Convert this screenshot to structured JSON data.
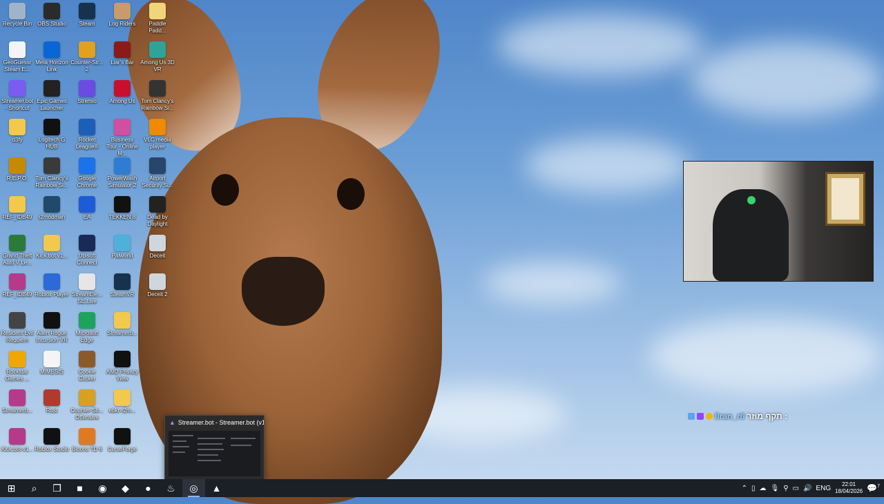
{
  "desktop_icons": [
    {
      "label": "Recycle Bin",
      "icon": "recycle-bin-icon",
      "color": "#9fb4c8"
    },
    {
      "label": "OBS Studio",
      "icon": "obs-icon",
      "color": "#2b2b2b"
    },
    {
      "label": "Steam",
      "icon": "steam-icon",
      "color": "#17324d"
    },
    {
      "label": "Log Riders",
      "icon": "game-icon",
      "color": "#c99b6b"
    },
    {
      "label": "Paddle Padd...",
      "icon": "game-icon",
      "color": "#f0d57a"
    },
    {
      "label": "GeoGuessr Steam E...",
      "icon": "file-icon",
      "color": "#f4f4f4"
    },
    {
      "label": "Meta Horizon Link",
      "icon": "meta-icon",
      "color": "#0a66d6"
    },
    {
      "label": "Counter-Str... 2",
      "icon": "game-icon",
      "color": "#e0a020"
    },
    {
      "label": "Liar's Bar",
      "icon": "game-icon",
      "color": "#8b1a1a"
    },
    {
      "label": "Among Us 3D VR",
      "icon": "game-icon",
      "color": "#2fa39a"
    },
    {
      "label": "Streamer.bot - Shortcut",
      "icon": "streamerbot-icon",
      "color": "#7b5cf0"
    },
    {
      "label": "Epic Games Launcher",
      "icon": "epic-icon",
      "color": "#222"
    },
    {
      "label": "Stremio",
      "icon": "stremio-icon",
      "color": "#6a4ce0"
    },
    {
      "label": "Among Us",
      "icon": "game-icon",
      "color": "#c8102e"
    },
    {
      "label": "Tom Clancy's Rainbow Si...",
      "icon": "game-icon",
      "color": "#333"
    },
    {
      "label": "d3fy",
      "icon": "folder-icon",
      "color": "#f2c94c"
    },
    {
      "label": "Logitech G HUB",
      "icon": "logitech-icon",
      "color": "#111"
    },
    {
      "label": "Rocket League®",
      "icon": "game-icon",
      "color": "#1d5fb8"
    },
    {
      "label": "Business Tour - Online M...",
      "icon": "game-icon",
      "color": "#d04fa0"
    },
    {
      "label": "VLC media player",
      "icon": "vlc-icon",
      "color": "#f08a00"
    },
    {
      "label": "R.E.P.O.",
      "icon": "game-icon",
      "color": "#c58a00"
    },
    {
      "label": "Tom Clancy's Rainbow Si...",
      "icon": "game-icon",
      "color": "#3a3a3a"
    },
    {
      "label": "Google Chrome",
      "icon": "chrome-icon",
      "color": "#1a73e8"
    },
    {
      "label": "PowerWash Simulator 2",
      "icon": "game-icon",
      "color": "#2f7dd3"
    },
    {
      "label": "Airport Security Si...",
      "icon": "game-icon",
      "color": "#27466a"
    },
    {
      "label": "REF_IDB49",
      "icon": "folder-icon",
      "color": "#f2c94c"
    },
    {
      "label": "r2modman",
      "icon": "r2modman-icon",
      "color": "#214a6a"
    },
    {
      "label": "EA",
      "icon": "ea-icon",
      "color": "#1e5bd8"
    },
    {
      "label": "TEKKEN 8",
      "icon": "game-icon",
      "color": "#111"
    },
    {
      "label": "Dead by Daylight",
      "icon": "game-icon",
      "color": "#222"
    },
    {
      "label": "Grand Theft Auto V Le...",
      "icon": "game-icon",
      "color": "#2c7a3a"
    },
    {
      "label": "Kick.bot v1...",
      "icon": "folder-icon",
      "color": "#f2c94c"
    },
    {
      "label": "Ubisoft Connect",
      "icon": "ubisoft-icon",
      "color": "#1a2a55"
    },
    {
      "label": "Palworld",
      "icon": "game-icon",
      "color": "#4fb0d9"
    },
    {
      "label": "Deceit",
      "icon": "game-icon",
      "color": "#cfd6dd"
    },
    {
      "label": "REF_IDB49",
      "icon": "archive-icon",
      "color": "#b53a8a"
    },
    {
      "label": "Roblox Player",
      "icon": "roblox-icon",
      "color": "#2b6ad8"
    },
    {
      "label": "StreamEle... SE.Live",
      "icon": "streamelements-icon",
      "color": "#e6e6e6"
    },
    {
      "label": "SteamVR",
      "icon": "steamvr-icon",
      "color": "#17324d"
    },
    {
      "label": "Deceit 2",
      "icon": "game-icon",
      "color": "#cfd6dd"
    },
    {
      "label": "Resident Evil Requiem",
      "icon": "game-icon",
      "color": "#444"
    },
    {
      "label": "Alien Rogue Incursion VR",
      "icon": "game-icon",
      "color": "#111"
    },
    {
      "label": "Microsoft Edge",
      "icon": "edge-icon",
      "color": "#1fa35c"
    },
    {
      "label": "Streamerb...",
      "icon": "folder-icon",
      "color": "#f2c94c"
    },
    {
      "label": "",
      "icon": "",
      "color": ""
    },
    {
      "label": "Rockstar Games ...",
      "icon": "rockstar-icon",
      "color": "#f0a800"
    },
    {
      "label": "MIMESIS",
      "icon": "file-icon",
      "color": "#f4f4f4"
    },
    {
      "label": "Cookie Clicker",
      "icon": "cookie-icon",
      "color": "#8b5a2b"
    },
    {
      "label": "AMD Privacy View",
      "icon": "amd-icon",
      "color": "#111"
    },
    {
      "label": "",
      "icon": "",
      "color": ""
    },
    {
      "label": "Streamerb...",
      "icon": "archive-icon",
      "color": "#b53a8a"
    },
    {
      "label": "Rust",
      "icon": "game-icon",
      "color": "#b03a2e"
    },
    {
      "label": "Counter-Str... Offensive",
      "icon": "game-icon",
      "color": "#d8a020"
    },
    {
      "label": "ebkr-r2m...",
      "icon": "folder-icon",
      "color": "#f2c94c"
    },
    {
      "label": "",
      "icon": "",
      "color": ""
    },
    {
      "label": "Kick.bot-v1...",
      "icon": "archive-icon",
      "color": "#b53a8a"
    },
    {
      "label": "Roblox Studio",
      "icon": "roblox-studio-icon",
      "color": "#111"
    },
    {
      "label": "Bloons TD 6",
      "icon": "game-icon",
      "color": "#e07a20"
    },
    {
      "label": "CurseForge",
      "icon": "curseforge-icon",
      "color": "#111"
    },
    {
      "label": "",
      "icon": "",
      "color": ""
    }
  ],
  "chat_overlay": {
    "user": "liran_r6",
    "message": "תקף מוזר :"
  },
  "thumbnail": {
    "title": "Streamer.bot - Streamer.bot (v1..."
  },
  "taskbar": {
    "apps": [
      {
        "name": "start-button",
        "glyph": "⊞"
      },
      {
        "name": "search-button",
        "glyph": "⌕"
      },
      {
        "name": "task-view-button",
        "glyph": "❐"
      },
      {
        "name": "file-explorer-button",
        "glyph": "■"
      },
      {
        "name": "chrome-button",
        "glyph": "◉"
      },
      {
        "name": "discord-button",
        "glyph": "◆"
      },
      {
        "name": "spotify-button",
        "glyph": "●"
      },
      {
        "name": "steam-button",
        "glyph": "♨"
      },
      {
        "name": "obs-button",
        "glyph": "◎"
      },
      {
        "name": "streamerbot-button",
        "glyph": "▲"
      }
    ],
    "lang": "ENG",
    "time": "22:01",
    "date": "18/04/2026",
    "notifications": "7"
  }
}
